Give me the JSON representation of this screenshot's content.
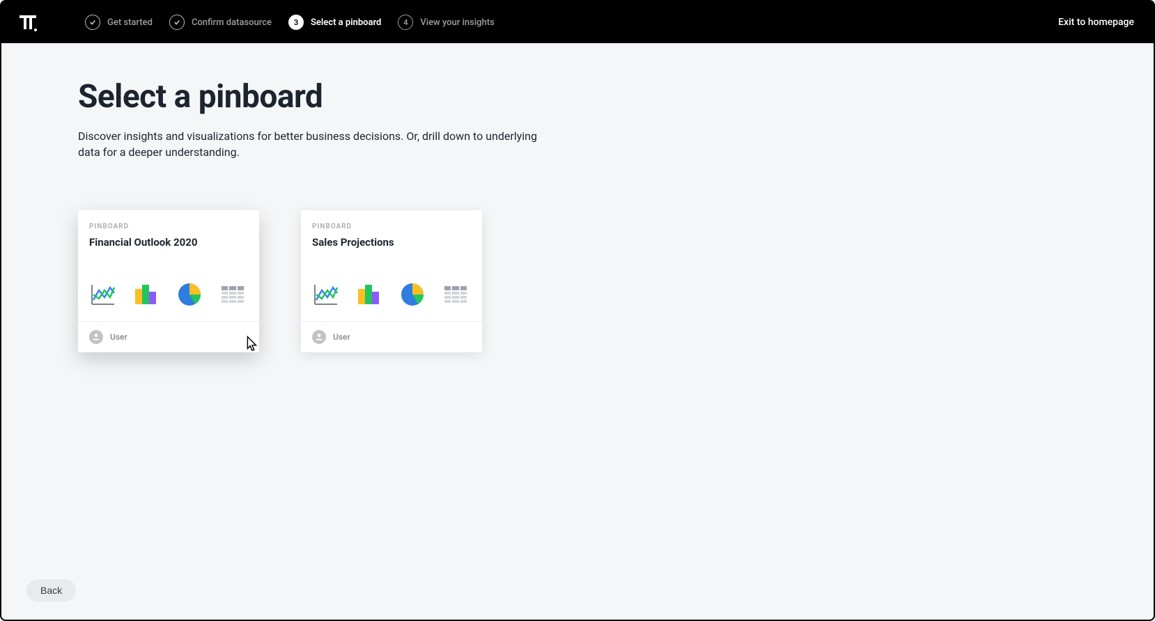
{
  "header": {
    "steps": [
      {
        "label": "Get started",
        "state": "done"
      },
      {
        "label": "Confirm datasource",
        "state": "done"
      },
      {
        "num": "3",
        "label": "Select a pinboard",
        "state": "active"
      },
      {
        "num": "4",
        "label": "View your insights",
        "state": "upcoming"
      }
    ],
    "exit_label": "Exit to homepage"
  },
  "page": {
    "title": "Select a pinboard",
    "subtitle": "Discover insights and visualizations for better business decisions. Or, drill down to underlying data for a deeper understanding."
  },
  "cards": [
    {
      "eyebrow": "PINBOARD",
      "title": "Financial Outlook 2020",
      "user": "User",
      "hover": true
    },
    {
      "eyebrow": "PINBOARD",
      "title": "Sales Projections",
      "user": "User",
      "hover": false
    }
  ],
  "footer": {
    "back_label": "Back"
  }
}
